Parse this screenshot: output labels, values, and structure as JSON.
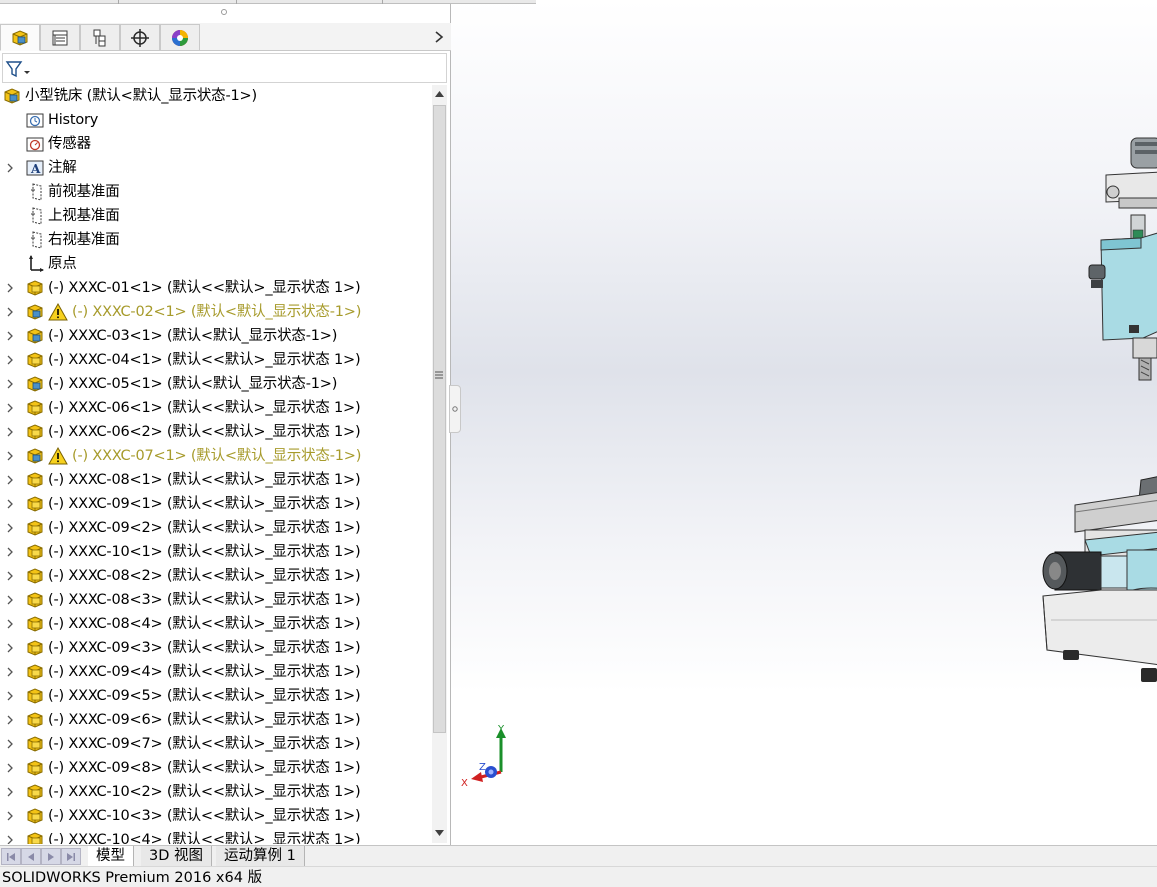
{
  "feature_tree": {
    "root_label": "小型铣床  (默认<默认_显示状态-1>)",
    "items": [
      {
        "label": "History",
        "icon": "history-folder-icon",
        "expandable": false,
        "warning": false
      },
      {
        "label": "传感器",
        "icon": "sensor-icon",
        "expandable": false,
        "warning": false
      },
      {
        "label": "注解",
        "icon": "annotation-icon",
        "expandable": true,
        "warning": false
      },
      {
        "label": "前视基准面",
        "icon": "plane-icon",
        "expandable": false,
        "warning": false
      },
      {
        "label": "上视基准面",
        "icon": "plane-icon",
        "expandable": false,
        "warning": false
      },
      {
        "label": "右视基准面",
        "icon": "plane-icon",
        "expandable": false,
        "warning": false
      },
      {
        "label": "原点",
        "icon": "origin-icon",
        "expandable": false,
        "warning": false
      },
      {
        "label": "(-) XXXC-01<1> (默认<<默认>_显示状态 1>)",
        "icon": "part-icon",
        "expandable": true,
        "warning": false
      },
      {
        "label": "(-) XXXC-02<1> (默认<默认_显示状态-1>)",
        "icon": "assembly-icon",
        "expandable": true,
        "warning": true
      },
      {
        "label": "(-) XXXC-03<1> (默认<默认_显示状态-1>)",
        "icon": "assembly-icon",
        "expandable": true,
        "warning": false
      },
      {
        "label": "(-) XXXC-04<1> (默认<<默认>_显示状态 1>)",
        "icon": "part-icon",
        "expandable": true,
        "warning": false
      },
      {
        "label": "(-) XXXC-05<1> (默认<默认_显示状态-1>)",
        "icon": "assembly-icon",
        "expandable": true,
        "warning": false
      },
      {
        "label": "(-) XXXC-06<1> (默认<<默认>_显示状态 1>)",
        "icon": "part-icon",
        "expandable": true,
        "warning": false
      },
      {
        "label": "(-) XXXC-06<2> (默认<<默认>_显示状态 1>)",
        "icon": "part-icon",
        "expandable": true,
        "warning": false
      },
      {
        "label": "(-) XXXC-07<1> (默认<默认_显示状态-1>)",
        "icon": "assembly-icon",
        "expandable": true,
        "warning": true
      },
      {
        "label": "(-) XXXC-08<1> (默认<<默认>_显示状态 1>)",
        "icon": "part-icon",
        "expandable": true,
        "warning": false
      },
      {
        "label": "(-) XXXC-09<1> (默认<<默认>_显示状态 1>)",
        "icon": "part-icon",
        "expandable": true,
        "warning": false
      },
      {
        "label": "(-) XXXC-09<2> (默认<<默认>_显示状态 1>)",
        "icon": "part-icon",
        "expandable": true,
        "warning": false
      },
      {
        "label": "(-) XXXC-10<1> (默认<<默认>_显示状态 1>)",
        "icon": "part-icon",
        "expandable": true,
        "warning": false
      },
      {
        "label": "(-) XXXC-08<2> (默认<<默认>_显示状态 1>)",
        "icon": "part-icon",
        "expandable": true,
        "warning": false
      },
      {
        "label": "(-) XXXC-08<3> (默认<<默认>_显示状态 1>)",
        "icon": "part-icon",
        "expandable": true,
        "warning": false
      },
      {
        "label": "(-) XXXC-08<4> (默认<<默认>_显示状态 1>)",
        "icon": "part-icon",
        "expandable": true,
        "warning": false
      },
      {
        "label": "(-) XXXC-09<3> (默认<<默认>_显示状态 1>)",
        "icon": "part-icon",
        "expandable": true,
        "warning": false
      },
      {
        "label": "(-) XXXC-09<4> (默认<<默认>_显示状态 1>)",
        "icon": "part-icon",
        "expandable": true,
        "warning": false
      },
      {
        "label": "(-) XXXC-09<5> (默认<<默认>_显示状态 1>)",
        "icon": "part-icon",
        "expandable": true,
        "warning": false
      },
      {
        "label": "(-) XXXC-09<6> (默认<<默认>_显示状态 1>)",
        "icon": "part-icon",
        "expandable": true,
        "warning": false
      },
      {
        "label": "(-) XXXC-09<7> (默认<<默认>_显示状态 1>)",
        "icon": "part-icon",
        "expandable": true,
        "warning": false
      },
      {
        "label": "(-) XXXC-09<8> (默认<<默认>_显示状态 1>)",
        "icon": "part-icon",
        "expandable": true,
        "warning": false
      },
      {
        "label": "(-) XXXC-10<2> (默认<<默认>_显示状态 1>)",
        "icon": "part-icon",
        "expandable": true,
        "warning": false
      },
      {
        "label": "(-) XXXC-10<3> (默认<<默认>_显示状态 1>)",
        "icon": "part-icon",
        "expandable": true,
        "warning": false
      },
      {
        "label": "(-) XXXC-10<4> (默认<<默认>_显示状态 1>)",
        "icon": "part-icon",
        "expandable": true,
        "warning": false
      }
    ]
  },
  "manager_tabs": [
    "featuremanager-icon",
    "propertymanager-icon",
    "configurationmanager-icon",
    "dimxpertmanager-icon",
    "displaymanager-icon"
  ],
  "view_tabs": {
    "model": "模型",
    "view_3d": "3D 视图",
    "motion": "运动算例 1"
  },
  "status_bar": {
    "text": "SOLIDWORKS Premium 2016 x64 版"
  },
  "triad": {
    "x": "X",
    "y": "Y",
    "z": "Z"
  },
  "colors": {
    "warning_text": "#a79b2c",
    "part_yellow": "#f3c316",
    "assembly_blue": "#4a90c8",
    "viewport_mid": "#dfe2ea"
  }
}
